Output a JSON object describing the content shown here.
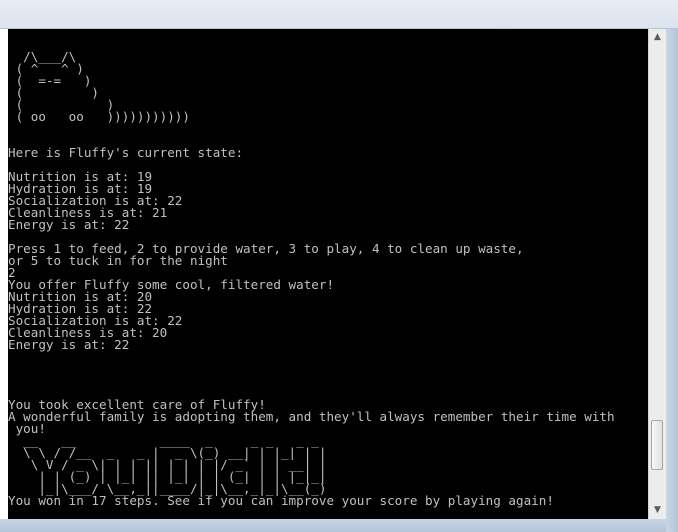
{
  "console": {
    "lines": [
      "  /\\___/\\",
      " ( ^   ^ )",
      " (  =-=   )",
      " (         )",
      " (           )",
      " ( oo   oo   )))))))))))",
      "",
      "",
      "Here is Fluffy's current state:",
      "",
      "Nutrition is at: 19",
      "Hydration is at: 19",
      "Socialization is at: 22",
      "Cleanliness is at: 21",
      "Energy is at: 22",
      "",
      "Press 1 to feed, 2 to provide water, 3 to play, 4 to clean up waste,",
      "or 5 to tuck in for the night",
      "2",
      "You offer Fluffy some cool, filtered water!",
      "Nutrition is at: 20",
      "Hydration is at: 22",
      "Socialization is at: 22",
      "Cleanliness is at: 20",
      "Energy is at: 22",
      "",
      "",
      "",
      "",
      "You took excellent care of Fluffy!",
      "A wonderful family is adopting them, and they'll always remember their time with",
      " you!",
      "  __   __           ____  _     _ _   _ _",
      "  \\ \\ / /__  _   _ |  _ \\(_) __| | |_| | |",
      "   \\ V / _ \\| | | || | | | |/ _` | | __| |",
      "    | | (_) | |_| || |_| | | (_| | | |_|_|",
      "    |_|\\___/ \\__,_||____/|_|\\__,_|_|\\__(_)",
      "You won in 17 steps. See if you can improve your score by playing again!"
    ]
  },
  "scrollbar": {
    "up_glyph": "▲",
    "down_glyph": "▼",
    "position": 0.92
  }
}
